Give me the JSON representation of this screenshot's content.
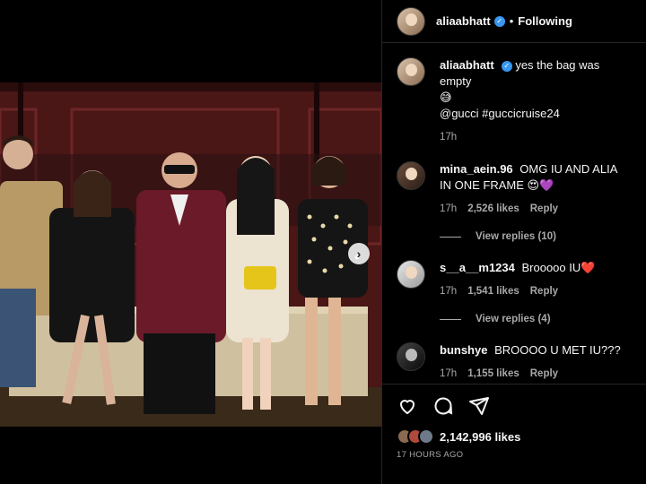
{
  "post": {
    "author": "aliaabhatt",
    "follow_status": "Following",
    "separator": "•",
    "caption": {
      "user": "aliaabhatt",
      "text": "yes the bag was empty",
      "emoji": "😅",
      "tags": "@gucci #guccicruise24",
      "time": "17h"
    }
  },
  "comments": [
    {
      "user": "mina_aein.96",
      "text": "OMG IU AND ALIA IN ONE FRAME",
      "emoji": "😍💜",
      "time": "17h",
      "likes": "2,526 likes",
      "reply": "Reply",
      "view_replies": "View replies (10)"
    },
    {
      "user": "s__a__m1234",
      "text": "Brooooo IU",
      "emoji": "❤️",
      "time": "17h",
      "likes": "1,541 likes",
      "reply": "Reply",
      "view_replies": "View replies (4)"
    },
    {
      "user": "bunshye",
      "text": "BROOOO U MET IU???",
      "emoji": "",
      "time": "17h",
      "likes": "1,155 likes",
      "reply": "Reply",
      "view_replies": ""
    }
  ],
  "footer": {
    "likes": "2,142,996 likes",
    "time_ago": "17 HOURS AGO"
  },
  "icons": {
    "like": "heart-icon",
    "comment": "comment-icon",
    "share": "share-icon",
    "next": "chevron-right-icon",
    "verified": "verified-badge-icon"
  },
  "colors": {
    "background": "#000000",
    "divider": "#262626",
    "muted_text": "#a8a8a8",
    "verified_blue": "#3897f0"
  }
}
